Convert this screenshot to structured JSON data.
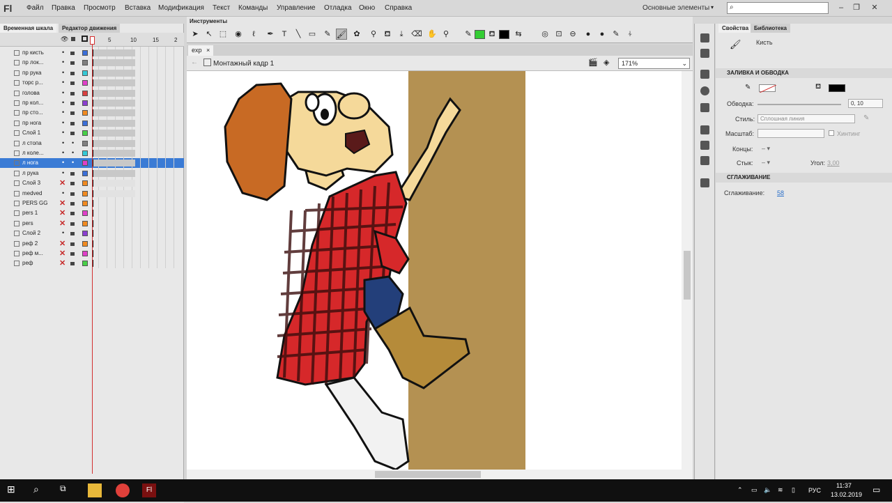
{
  "app": {
    "logo": "Fl"
  },
  "menu": [
    "Файл",
    "Правка",
    "Просмотр",
    "Вставка",
    "Модификация",
    "Текст",
    "Команды",
    "Управление",
    "Отладка",
    "Окно",
    "Справка"
  ],
  "workspace": "Основные элементы",
  "search": {
    "placeholder": ""
  },
  "leftpanel": {
    "tabs": [
      "Временная шкала",
      "Редактор движения"
    ],
    "frame_numbers": [
      "1",
      "5",
      "10",
      "15",
      "2"
    ],
    "layers": [
      {
        "name": "пр кисть",
        "color": "#3b6fd8",
        "locked": true,
        "hidden": false
      },
      {
        "name": "пр лок...",
        "color": "#808080",
        "locked": true,
        "hidden": false
      },
      {
        "name": "пр рука",
        "color": "#35c9d6",
        "locked": true,
        "hidden": false
      },
      {
        "name": "торс р...",
        "color": "#e040c8",
        "locked": true,
        "hidden": false
      },
      {
        "name": "голова",
        "color": "#d94040",
        "locked": true,
        "hidden": false
      },
      {
        "name": "пр кол...",
        "color": "#8b3fd0",
        "locked": true,
        "hidden": false
      },
      {
        "name": "пр сто...",
        "color": "#f08a20",
        "locked": true,
        "hidden": false
      },
      {
        "name": "пр нога",
        "color": "#3b6fd8",
        "locked": true,
        "hidden": false
      },
      {
        "name": "Слой 1",
        "color": "#48d048",
        "locked": true,
        "hidden": false
      },
      {
        "name": "л стопа",
        "color": "#808080",
        "locked": false,
        "hidden": false
      },
      {
        "name": "л коле...",
        "color": "#35c9d6",
        "locked": false,
        "hidden": false
      },
      {
        "name": "л нога",
        "color": "#e040c8",
        "locked": false,
        "hidden": false,
        "selected": true
      },
      {
        "name": "л рука",
        "color": "#3b6fd8",
        "locked": true,
        "hidden": false
      },
      {
        "name": "Слой 3",
        "color": "#f08a20",
        "locked": true,
        "hidden": true
      },
      {
        "name": "medved",
        "color": "#f08a20",
        "locked": true,
        "hidden": false
      },
      {
        "name": "PERS GG",
        "color": "#f08a20",
        "locked": true,
        "hidden": true
      },
      {
        "name": "pers 1",
        "color": "#e040c8",
        "locked": true,
        "hidden": true
      },
      {
        "name": "pers",
        "color": "#f08a20",
        "locked": true,
        "hidden": true
      },
      {
        "name": "Слой 2",
        "color": "#8b3fd0",
        "locked": true,
        "hidden": false
      },
      {
        "name": "реф 2",
        "color": "#f08a20",
        "locked": true,
        "hidden": true
      },
      {
        "name": "реф м...",
        "color": "#e040c8",
        "locked": true,
        "hidden": true
      },
      {
        "name": "реф",
        "color": "#48d048",
        "locked": true,
        "hidden": true
      }
    ]
  },
  "tools": {
    "title": "Инструменты",
    "stroke_color": "#33cc33",
    "fill_color": "#000000"
  },
  "doc": {
    "tab": "exp",
    "scene": "Монтажный кадр 1",
    "zoom": "171%"
  },
  "props": {
    "tabs": [
      "Свойства",
      "Библиотека"
    ],
    "tool_name": "Кисть",
    "sec_fill": "ЗАЛИВКА И ОБВОДКА",
    "stroke_label": "Обводка:",
    "stroke_value": "0, 10",
    "style_label": "Стиль:",
    "style_value": "Сплошная линия",
    "scale_label": "Масштаб:",
    "hinting": "Хинтинг",
    "caps_label": "Концы:",
    "join_label": "Стык:",
    "angle_label": "Угол:",
    "angle_value": "3,00",
    "sec_smooth": "СГЛАЖИВАНИЕ",
    "smooth_label": "Сглаживание:",
    "smooth_value": "58",
    "fill_color": "#000000"
  },
  "taskbar": {
    "lang": "РУС",
    "time": "11:37",
    "date": "13.02.2019"
  }
}
